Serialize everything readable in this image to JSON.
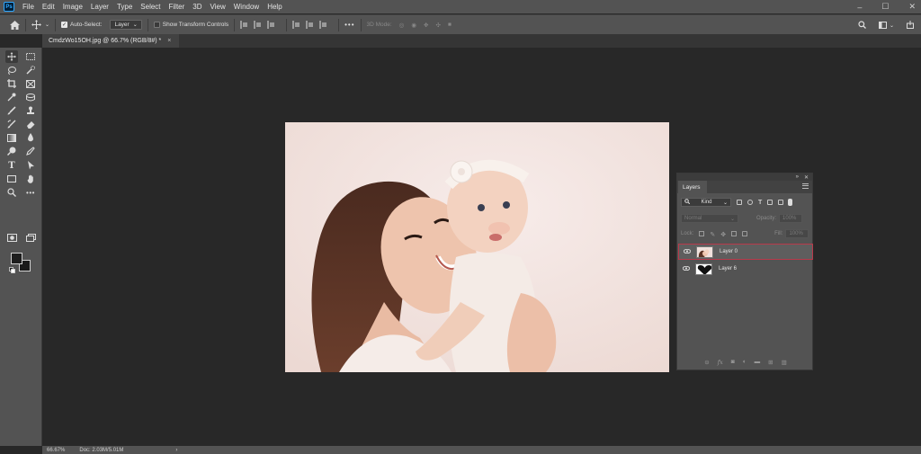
{
  "app": {
    "logo": "Ps"
  },
  "menu": [
    "File",
    "Edit",
    "Image",
    "Layer",
    "Type",
    "Select",
    "Filter",
    "3D",
    "View",
    "Window",
    "Help"
  ],
  "window_controls": {
    "minimize": "–",
    "maximize": "☐",
    "close": "✕"
  },
  "options": {
    "auto_select_label": "Auto-Select:",
    "auto_select_checked": true,
    "target_value": "Layer",
    "show_transform_label": "Show Transform Controls",
    "show_transform_checked": false,
    "more_label": "•••",
    "mode_3d_label": "3D Mode:"
  },
  "document_tab": {
    "title": "CmdzWo15OH.jpg @ 66.7% (RGB/8#) *",
    "close": "×"
  },
  "status": {
    "zoom": "66.67%",
    "doc_info": "Doc: 2.03M/5.01M",
    "arrow": "›"
  },
  "layers_panel": {
    "tab_label": "Layers",
    "filter_kind": "Kind",
    "blend_mode": "Normal",
    "opacity_label": "Opacity:",
    "opacity_value": "100%",
    "lock_label": "Lock:",
    "fill_label": "Fill:",
    "fill_value": "100%",
    "layers": [
      {
        "name": "Layer 0",
        "selected": true
      },
      {
        "name": "Layer 6",
        "selected": false
      }
    ],
    "bottom_icons": [
      "link-icon",
      "fx-icon",
      "mask-icon",
      "adjustment-icon",
      "group-icon",
      "new-layer-icon",
      "trash-icon"
    ]
  },
  "colors": {
    "selected_layer_outline": "#b83a4b",
    "foreground": "#1e1e1e",
    "background": "#1a1a1a",
    "photo_backdrop": "#f1e2dd"
  }
}
